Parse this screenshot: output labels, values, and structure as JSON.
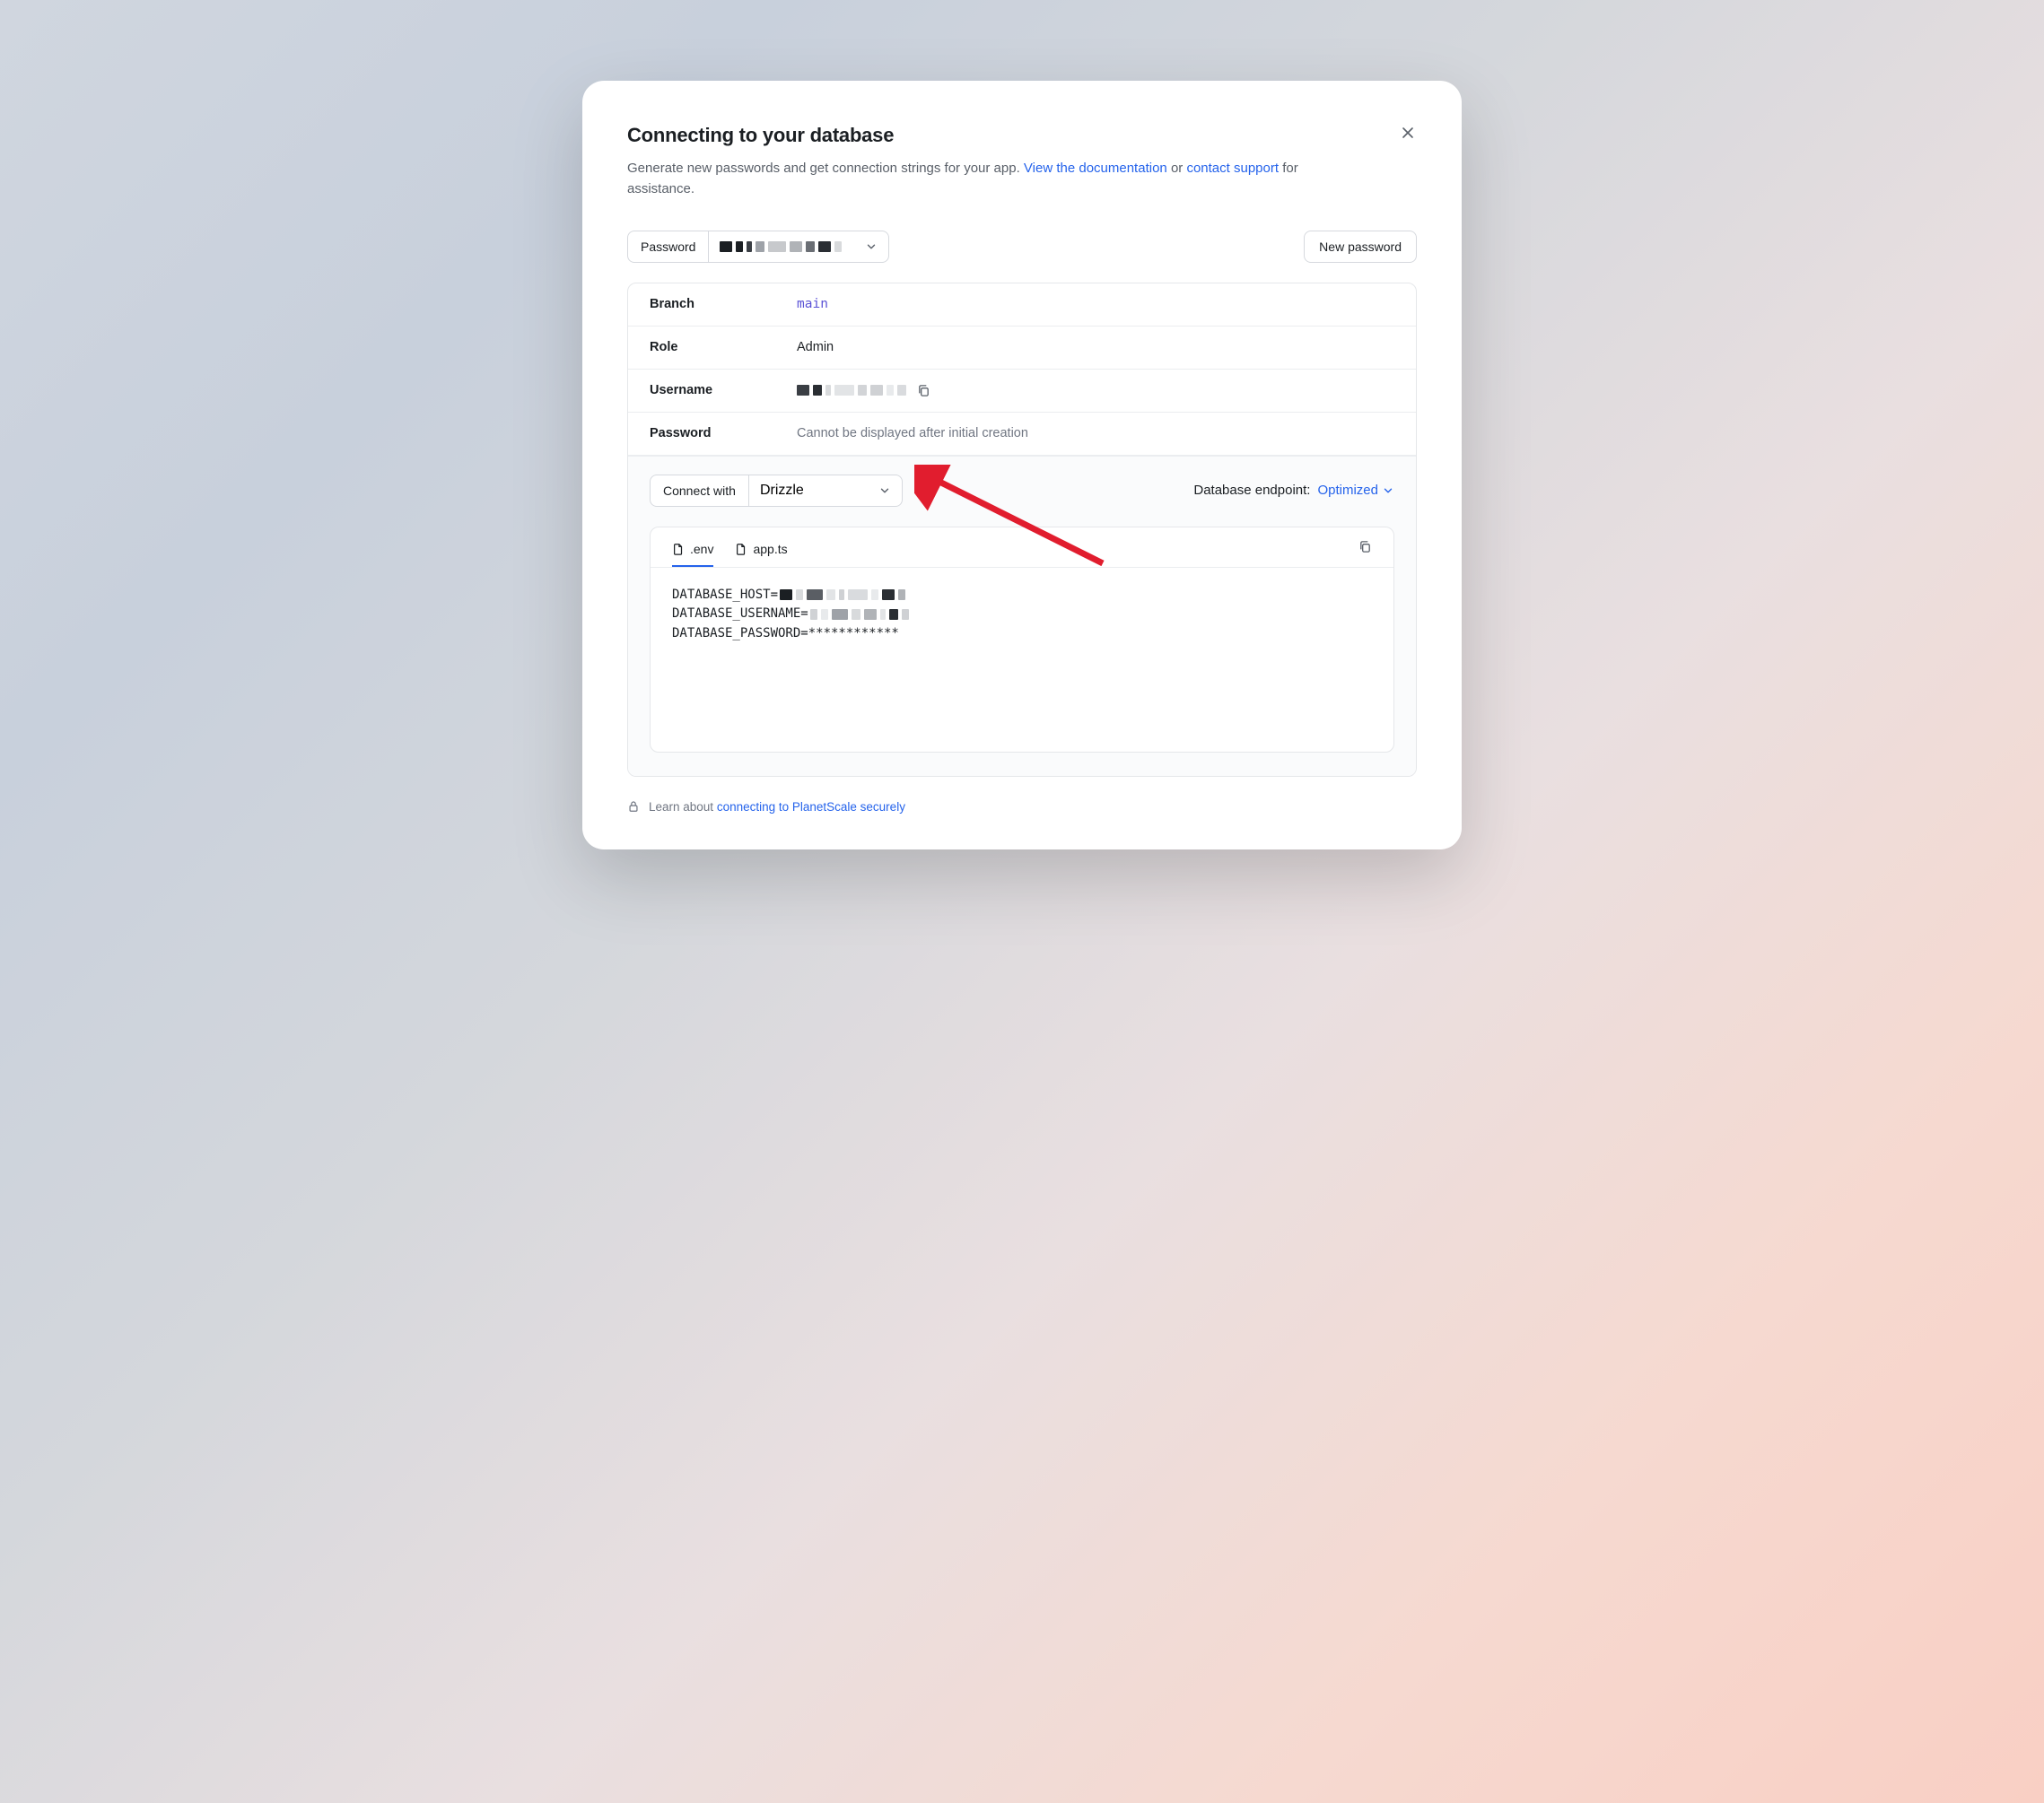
{
  "header": {
    "title": "Connecting to your database",
    "subtitle_pre": "Generate new passwords and get connection strings for your app. ",
    "doc_link": "View the documentation",
    "subtitle_mid": " or ",
    "support_link": "contact support",
    "subtitle_post": " for assistance."
  },
  "toolbar": {
    "password_label": "Password",
    "new_password": "New password"
  },
  "details": {
    "branch_label": "Branch",
    "branch_value": "main",
    "role_label": "Role",
    "role_value": "Admin",
    "username_label": "Username",
    "password_label": "Password",
    "password_value": "Cannot be displayed after initial creation"
  },
  "connect": {
    "label": "Connect with",
    "selected": "Drizzle",
    "endpoint_label": "Database endpoint:",
    "endpoint_value": "Optimized"
  },
  "code": {
    "tab_env": ".env",
    "tab_appts": "app.ts",
    "line1_prefix": "DATABASE_HOST=",
    "line2_prefix": "DATABASE_USERNAME=",
    "line3": "DATABASE_PASSWORD=************"
  },
  "footer": {
    "pre": "Learn about ",
    "link": "connecting to PlanetScale securely"
  }
}
